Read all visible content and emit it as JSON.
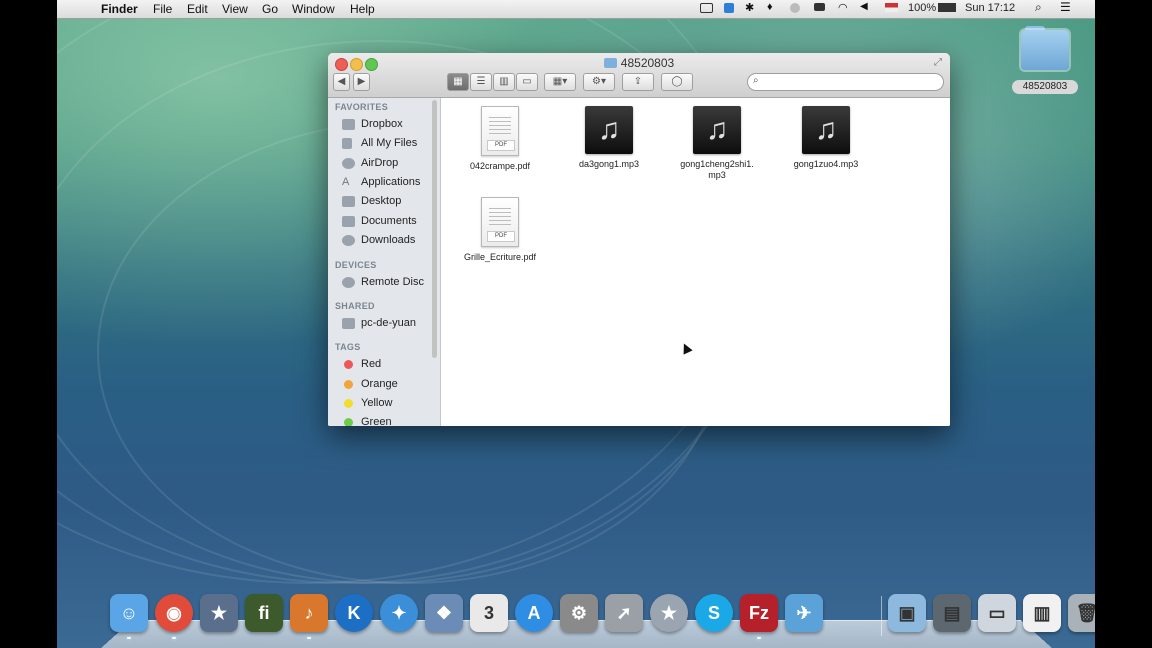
{
  "menubar": {
    "apple": "",
    "app": "Finder",
    "items": [
      "File",
      "Edit",
      "View",
      "Go",
      "Window",
      "Help"
    ],
    "battery": "100%",
    "clock": "Sun 17:12",
    "icons": [
      "screen-record-icon",
      "dropbox-icon",
      "bluetooth-icon",
      "flame-icon",
      "sync-icon",
      "keyboard-icon",
      "wifi-icon",
      "volume-icon",
      "flag-us-icon",
      "battery-icon",
      "spotlight-icon",
      "notification-list-icon"
    ]
  },
  "desktop": {
    "folder_label": "48520803"
  },
  "window": {
    "title": "48520803",
    "search_placeholder": "",
    "sidebar": {
      "favorites_header": "FAVORITES",
      "favorites": [
        "Dropbox",
        "All My Files",
        "AirDrop",
        "Applications",
        "Desktop",
        "Documents",
        "Downloads"
      ],
      "devices_header": "DEVICES",
      "devices": [
        "Remote Disc"
      ],
      "shared_header": "SHARED",
      "shared": [
        "pc-de-yuan"
      ],
      "tags_header": "TAGS",
      "tags": [
        {
          "label": "Red",
          "color": "#f0575a"
        },
        {
          "label": "Orange",
          "color": "#f3a43a"
        },
        {
          "label": "Yellow",
          "color": "#f2dc2c"
        },
        {
          "label": "Green",
          "color": "#6dcc48"
        }
      ]
    },
    "files": [
      {
        "name": "042crampe.pdf",
        "kind": "pdf",
        "badge": "PDF"
      },
      {
        "name": "da3gong1.mp3",
        "kind": "mp3"
      },
      {
        "name": "gong1cheng2shi1.\nmp3",
        "kind": "mp3"
      },
      {
        "name": "gong1zuo4.mp3",
        "kind": "mp3"
      },
      {
        "name": "Grille_Ecriture.pdf",
        "kind": "pdf",
        "badge": "PDF"
      }
    ]
  },
  "dock": {
    "apps": [
      {
        "name": "finder-icon",
        "glyph": "☺",
        "color": "#5aa5e6"
      },
      {
        "name": "chrome-icon",
        "glyph": "◉",
        "color": "#e04b3a"
      },
      {
        "name": "imovie-icon",
        "glyph": "★",
        "color": "#5a6f8c"
      },
      {
        "name": "typography-app-icon",
        "glyph": "fi",
        "color": "#3d5a2c"
      },
      {
        "name": "garageband-icon",
        "glyph": "♪",
        "color": "#d9782c"
      },
      {
        "name": "k-app-icon",
        "glyph": "K",
        "color": "#1c6fc5"
      },
      {
        "name": "safari-icon",
        "glyph": "✦",
        "color": "#3a8fd8"
      },
      {
        "name": "preview-icon",
        "glyph": "❖",
        "color": "#6b8cb6"
      },
      {
        "name": "calendar-icon",
        "glyph": "3",
        "color": "#e9e9e9"
      },
      {
        "name": "app-store-icon",
        "glyph": "A",
        "color": "#2f8de4"
      },
      {
        "name": "system-preferences-icon",
        "glyph": "⚙",
        "color": "#8a8a8a"
      },
      {
        "name": "launchpad-icon",
        "glyph": "➚",
        "color": "#9aa0a6"
      },
      {
        "name": "star-app-icon",
        "glyph": "★",
        "color": "#9aa5b1"
      },
      {
        "name": "skype-icon",
        "glyph": "S",
        "color": "#1aa9e6"
      },
      {
        "name": "filezilla-icon",
        "glyph": "Fz",
        "color": "#b5202a"
      },
      {
        "name": "bird-app-icon",
        "glyph": "✈",
        "color": "#5aa2d8"
      }
    ],
    "right": [
      {
        "name": "folder-stack-icon",
        "glyph": "▣",
        "color": "#8cb9dd"
      },
      {
        "name": "printer-icon",
        "glyph": "▤",
        "color": "#5c6770"
      },
      {
        "name": "scanner-icon",
        "glyph": "▭",
        "color": "#cfd6de"
      },
      {
        "name": "documents-stack-icon",
        "glyph": "▥",
        "color": "#f1f1f1"
      },
      {
        "name": "trash-icon",
        "glyph": "🗑",
        "color": "#a9b1b9"
      }
    ]
  }
}
